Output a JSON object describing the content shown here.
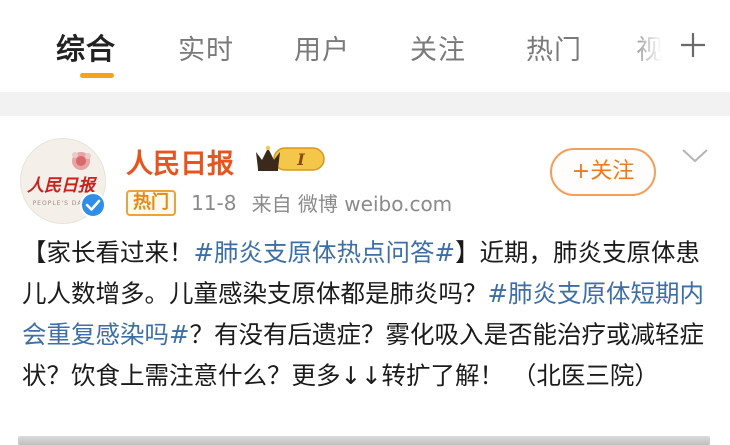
{
  "tabs": [
    {
      "label": "综合",
      "active": true
    },
    {
      "label": "实时",
      "active": false
    },
    {
      "label": "用户",
      "active": false
    },
    {
      "label": "关注",
      "active": false
    },
    {
      "label": "热门",
      "active": false
    },
    {
      "label": "视",
      "active": false
    }
  ],
  "post": {
    "author": "人民日报",
    "avatar_text": "人民日报",
    "member_badge_text": "I",
    "hot_badge": "热门",
    "date": "11-8",
    "source": "来自 微博 weibo.com",
    "follow_label": "+关注",
    "content_prefix": "【家长看过来！",
    "topic1": "#肺炎支原体热点问答#",
    "content_mid": "】近期，肺炎支原体患儿人数增多。儿童感染支原体都是肺炎吗？",
    "topic2": "#肺炎支原体短期内会重复感染吗#",
    "content_suffix": "？有没有后遗症？雾化吸入是否能治疗或减轻症状？饮食上需注意什么？更多↓↓转扩了解！ （北医三院）"
  },
  "colors": {
    "accent_orange": "#f7a21b",
    "author_red": "#e8541e",
    "topic_blue": "#3d6ea8",
    "verified_blue": "#2f8ee8"
  }
}
